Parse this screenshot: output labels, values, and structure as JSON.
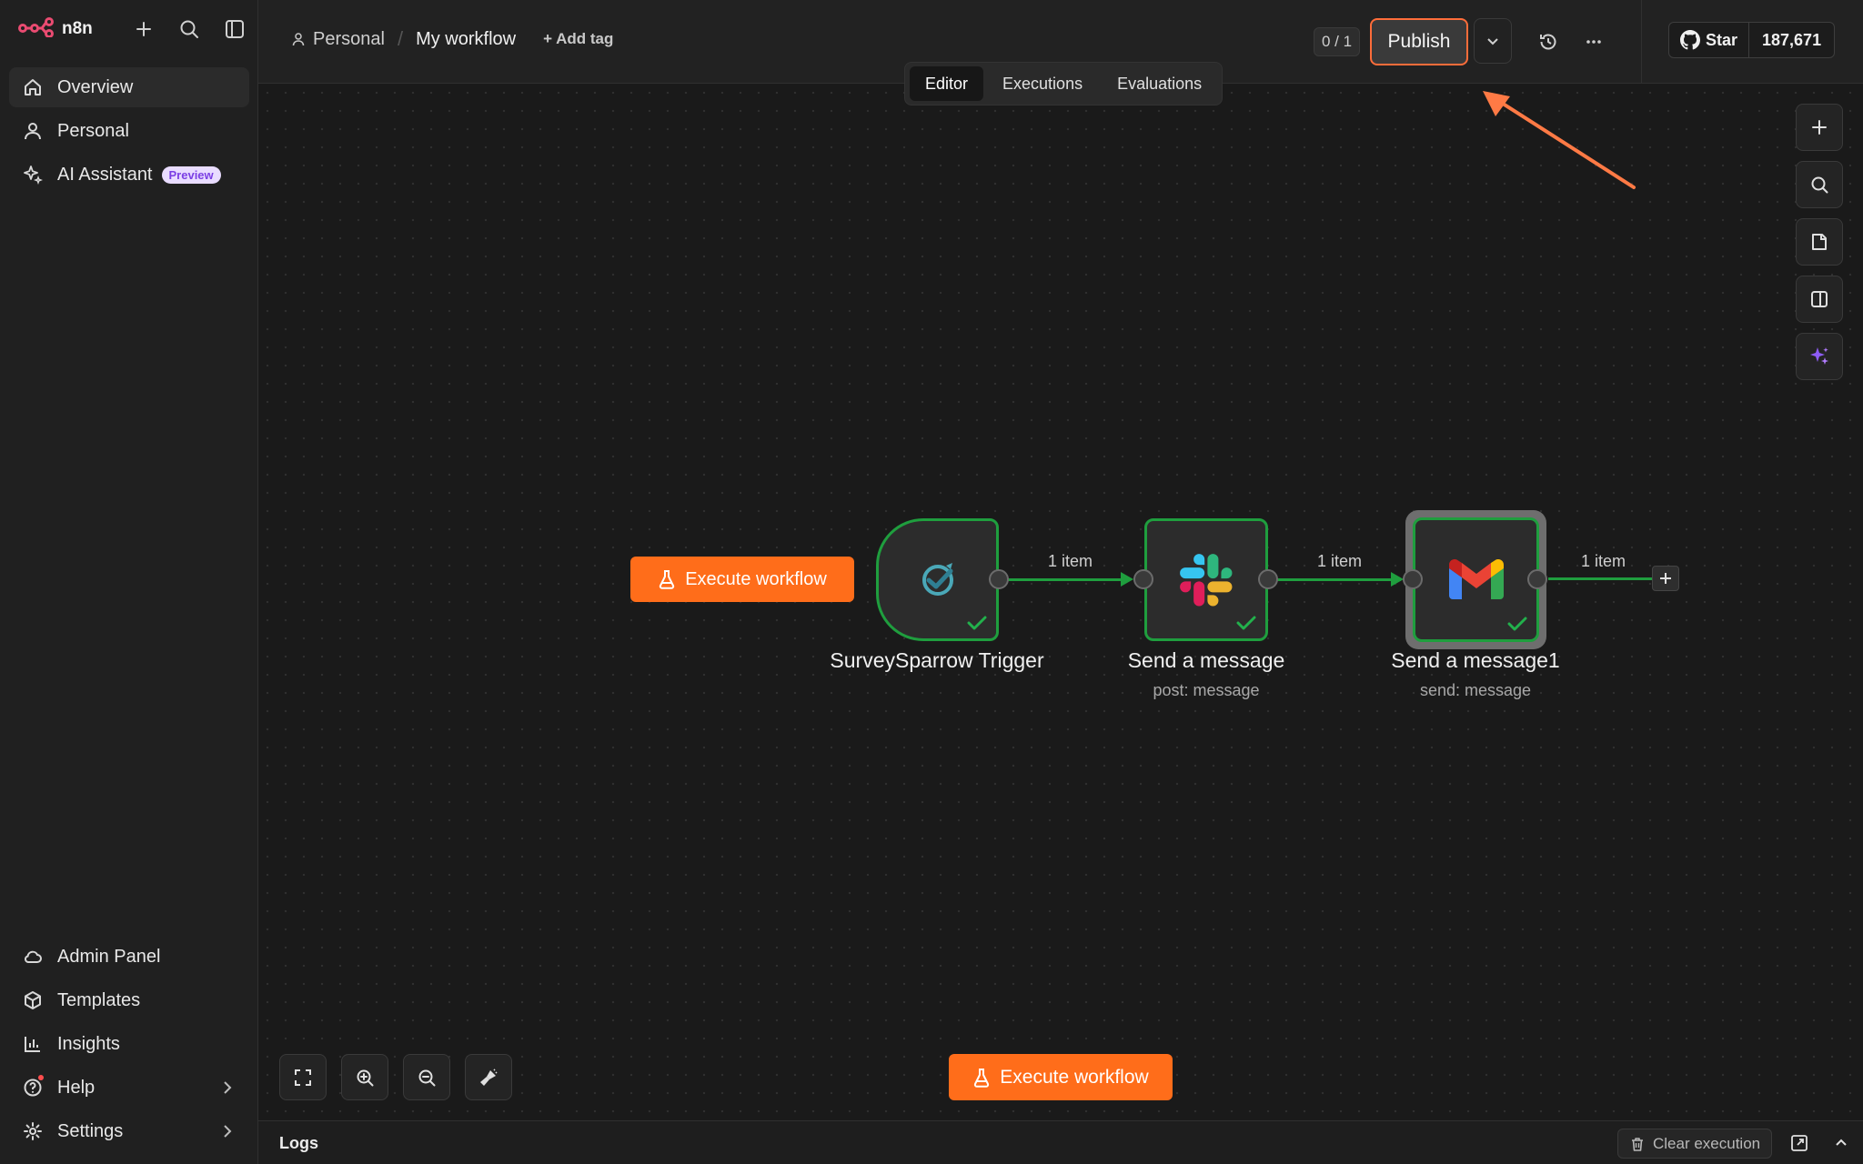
{
  "app": {
    "logo_text": "n8n"
  },
  "sidebar": {
    "top_items": [
      {
        "label": "Overview",
        "icon": "home-icon"
      },
      {
        "label": "Personal",
        "icon": "user-icon"
      },
      {
        "label": "AI Assistant",
        "icon": "sparkle-icon",
        "badge": "Preview"
      }
    ],
    "bottom_items": [
      {
        "label": "Admin Panel",
        "icon": "cloud-icon"
      },
      {
        "label": "Templates",
        "icon": "templates-icon"
      },
      {
        "label": "Insights",
        "icon": "insights-icon"
      },
      {
        "label": "Help",
        "icon": "help-icon"
      },
      {
        "label": "Settings",
        "icon": "gear-icon"
      }
    ]
  },
  "header": {
    "breadcrumb_project": "Personal",
    "workflow_name": "My workflow",
    "add_tag": "+ Add tag",
    "counter": "0 / 1",
    "publish_label": "Publish",
    "github_star": "Star",
    "github_count": "187,671"
  },
  "tabs": [
    {
      "label": "Editor",
      "active": true
    },
    {
      "label": "Executions",
      "active": false
    },
    {
      "label": "Evaluations",
      "active": false
    }
  ],
  "canvas": {
    "execute_label": "Execute workflow",
    "nodes": [
      {
        "title": "SurveySparrow Trigger",
        "subtitle": ""
      },
      {
        "title": "Send a message",
        "subtitle": "post: message"
      },
      {
        "title": "Send a message1",
        "subtitle": "send: message"
      }
    ],
    "connections": [
      {
        "label": "1 item"
      },
      {
        "label": "1 item"
      },
      {
        "label": "1 item"
      }
    ]
  },
  "logs": {
    "label": "Logs",
    "clear_label": "Clear execution"
  },
  "colors": {
    "accent": "#ff6d1a",
    "success": "#1f9e3e",
    "annotation": "#ff7a45"
  }
}
